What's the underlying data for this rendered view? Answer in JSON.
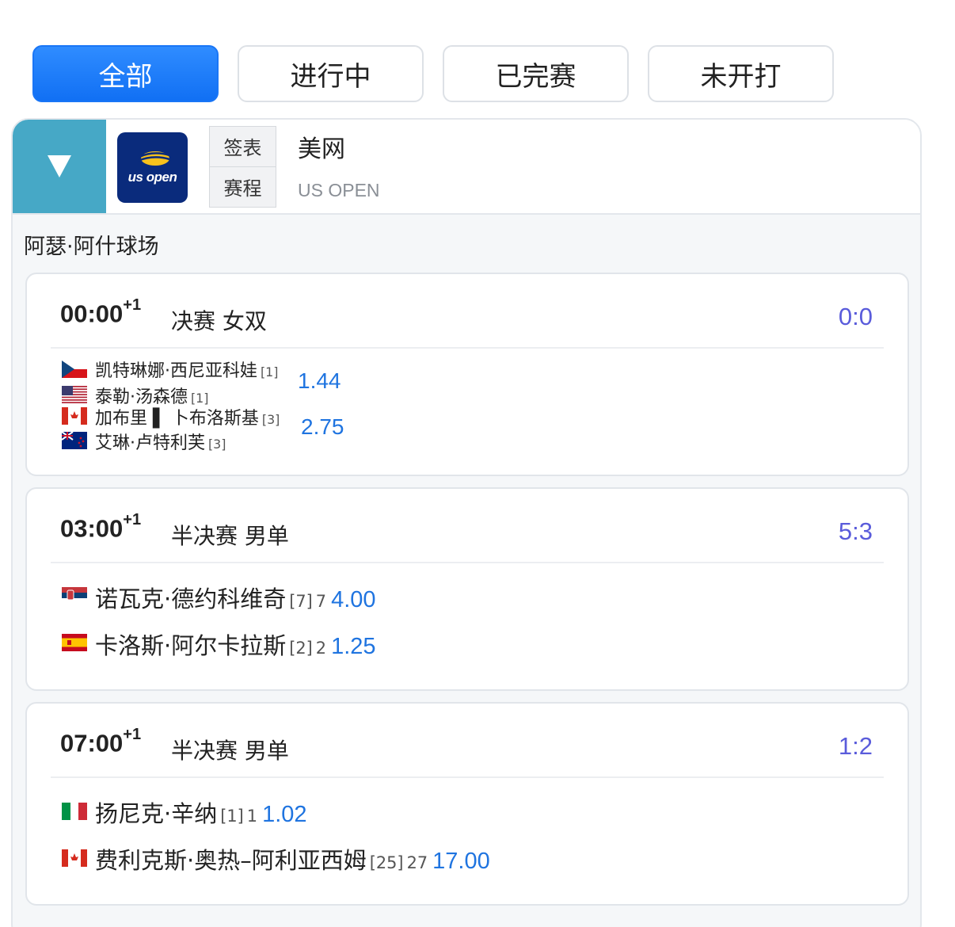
{
  "filter_tabs": [
    "全部",
    "进行中",
    "已完赛",
    "未开打"
  ],
  "tournament": {
    "name": "美网",
    "name_en": "US OPEN",
    "logo_text": "us open",
    "link_draw": "签表",
    "link_schedule": "赛程"
  },
  "venue": "阿瑟·阿什球场",
  "matches": [
    {
      "time": "00:00",
      "day_offset": "+1",
      "round": "决赛 女双",
      "score": "0:0",
      "team1": {
        "players": [
          {
            "name": "凯特琳娜·西尼亚科娃",
            "seed": "[1]",
            "flag": "czech"
          },
          {
            "name": "泰勒·汤森德",
            "seed": "[1]",
            "flag": "usa"
          }
        ],
        "odds": "1.44"
      },
      "team2": {
        "players": [
          {
            "name": "加布里 ▌ 卜布洛斯基",
            "seed": "[3]",
            "flag": "canada"
          },
          {
            "name": "艾琳·卢特利芙",
            "seed": "[3]",
            "flag": "new-zealand"
          }
        ],
        "odds": "2.75"
      }
    },
    {
      "time": "03:00",
      "day_offset": "+1",
      "round": "半决赛 男单",
      "score": "5:3",
      "player1": {
        "name": "诺瓦克·德约科维奇",
        "seed": "[7]",
        "rank": "7",
        "odds": "4.00",
        "flag": "serbia"
      },
      "player2": {
        "name": "卡洛斯·阿尔卡拉斯",
        "seed": "[2]",
        "rank": "2",
        "odds": "1.25",
        "flag": "spain"
      }
    },
    {
      "time": "07:00",
      "day_offset": "+1",
      "round": "半决赛 男单",
      "score": "1:2",
      "player1": {
        "name": "扬尼克·辛纳",
        "seed": "[1]",
        "rank": "1",
        "odds": "1.02",
        "flag": "italy"
      },
      "player2": {
        "name": "费利克斯·奥热–阿利亚西姆",
        "seed": "[25]",
        "rank": "27",
        "odds": "17.00",
        "flag": "canada"
      }
    }
  ],
  "colors": {
    "accent_blue": "#1170f4",
    "score_purple": "#5a5cdb",
    "odds_blue": "#1f74e0",
    "collapse_teal": "#46a8c6",
    "logo_navy": "#0a2b7c"
  }
}
